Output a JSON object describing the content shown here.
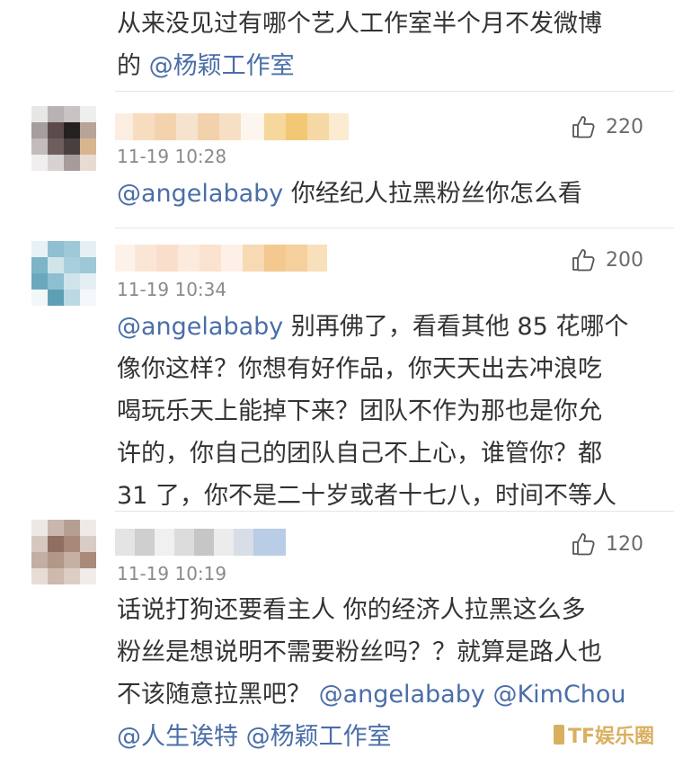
{
  "top_comment": {
    "line1": "从来没见过有哪个艺人工作室半个月不发微博",
    "line2_prefix": "的 ",
    "line2_mention": "@杨颖工作室"
  },
  "comments": [
    {
      "time": "11-19 10:28",
      "likes": "220",
      "mention": "@angelababy",
      "text": " 你经纪人拉黑粉丝你怎么看"
    },
    {
      "time": "11-19 10:34",
      "likes": "200",
      "mention": "@angelababy",
      "lines": [
        " 别再佛了，看看其他 85 花哪个",
        "像你这样？你想有好作品，你天天出去冲浪吃",
        "喝玩乐天上能掉下来？团队不作为那也是你允",
        "许的，你自己的团队自己不上心，谁管你？都",
        "31 了，你不是二十岁或者十七八，时间不等人"
      ]
    },
    {
      "time": "11-19 10:19",
      "likes": "120",
      "line1": "话说打狗还要看主人 你的经济人拉黑这么多",
      "line2": "粉丝是想说明不需要粉丝吗？？就算是路人也",
      "line3_prefix": "不该随意拉黑吧？ ",
      "line3_mention1": "@angelababy",
      "line3_mention2": " @KimChou",
      "line4_mention1": "@人生诶特",
      "line4_mention2": " @杨颖工作室"
    }
  ],
  "icons": {
    "like": "thumbs-up-icon"
  },
  "watermark": "TF娱乐圈",
  "colors": {
    "mention": "#4a6ea8",
    "time": "#8a8a8a",
    "text": "#333333"
  }
}
